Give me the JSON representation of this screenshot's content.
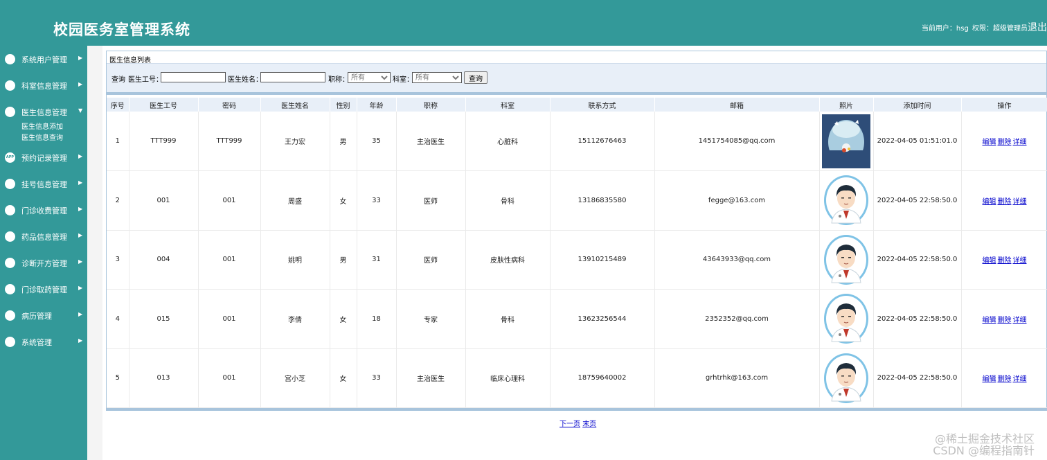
{
  "header": {
    "app_title": "校园医务室管理系统",
    "user_label": "当前用户：hsg",
    "role_label": "权限：超级管理员",
    "logout": "退出"
  },
  "sidebar": {
    "items": [
      {
        "label": "系统用户管理",
        "icon": "monitor-icon"
      },
      {
        "label": "科室信息管理",
        "icon": "users-icon"
      },
      {
        "label": "医生信息管理",
        "icon": "doctor-icon",
        "expanded": true,
        "children": [
          {
            "label": "医生信息添加"
          },
          {
            "label": "医生信息查询"
          }
        ]
      },
      {
        "label": "预约记录管理",
        "icon": "app-icon",
        "icon_text": "APP"
      },
      {
        "label": "挂号信息管理",
        "icon": "car-icon"
      },
      {
        "label": "门诊收费管理",
        "icon": "target-icon"
      },
      {
        "label": "药品信息管理",
        "icon": "target-icon"
      },
      {
        "label": "诊断开方管理",
        "icon": "target-icon"
      },
      {
        "label": "门诊取药管理",
        "icon": "target-icon"
      },
      {
        "label": "病历管理",
        "icon": "target-icon"
      },
      {
        "label": "系统管理",
        "icon": "chart-icon"
      }
    ]
  },
  "panel": {
    "title": "医生信息列表",
    "search": {
      "query_label": "查询",
      "doctor_no_label": "医生工号：",
      "doctor_no_value": "",
      "doctor_name_label": "医生姓名：",
      "doctor_name_value": "",
      "title_label": "职称：",
      "title_selected": "所有",
      "dept_label": "科室：",
      "dept_selected": "所有",
      "query_button": "查询"
    }
  },
  "table": {
    "columns": [
      "序号",
      "医生工号",
      "密码",
      "医生姓名",
      "性别",
      "年龄",
      "职称",
      "科室",
      "联系方式",
      "邮箱",
      "照片",
      "添加时间",
      "操作"
    ],
    "rows": [
      {
        "idx": "1",
        "no": "TTT999",
        "pwd": "TTT999",
        "name": "王力宏",
        "sex": "男",
        "age": "35",
        "title": "主治医生",
        "dept": "心脏科",
        "phone": "15112676463",
        "email": "1451754085@qq.com",
        "photo": "landscape",
        "time": "2022-04-05 01:51:01.0"
      },
      {
        "idx": "2",
        "no": "001",
        "pwd": "001",
        "name": "周盛",
        "sex": "女",
        "age": "33",
        "title": "医师",
        "dept": "骨科",
        "phone": "13186835580",
        "email": "fegge@163.com",
        "photo": "avatar",
        "time": "2022-04-05 22:58:50.0"
      },
      {
        "idx": "3",
        "no": "004",
        "pwd": "001",
        "name": "姚明",
        "sex": "男",
        "age": "31",
        "title": "医师",
        "dept": "皮肤性病科",
        "phone": "13910215489",
        "email": "43643933@qq.com",
        "photo": "avatar",
        "time": "2022-04-05 22:58:50.0"
      },
      {
        "idx": "4",
        "no": "015",
        "pwd": "001",
        "name": "李倩",
        "sex": "女",
        "age": "18",
        "title": "专家",
        "dept": "骨科",
        "phone": "13623256544",
        "email": "2352352@qq.com",
        "photo": "avatar",
        "time": "2022-04-05 22:58:50.0"
      },
      {
        "idx": "5",
        "no": "013",
        "pwd": "001",
        "name": "宫小芝",
        "sex": "女",
        "age": "33",
        "title": "主治医生",
        "dept": "临床心理科",
        "phone": "18759640002",
        "email": "grhtrhk@163.com",
        "photo": "avatar",
        "time": "2022-04-05 22:58:50.0"
      }
    ],
    "ops": {
      "edit": "编辑",
      "delete": "删除",
      "detail": "详细"
    }
  },
  "pager": {
    "next": "下一页",
    "last": "末页"
  },
  "watermark": {
    "line1": "@稀土掘金技术社区",
    "line2": "CSDN @编程指南针"
  },
  "colors": {
    "theme": "#339999",
    "table_header": "#e8eff8",
    "border": "#a8c4dc",
    "link": "#0000cc"
  }
}
